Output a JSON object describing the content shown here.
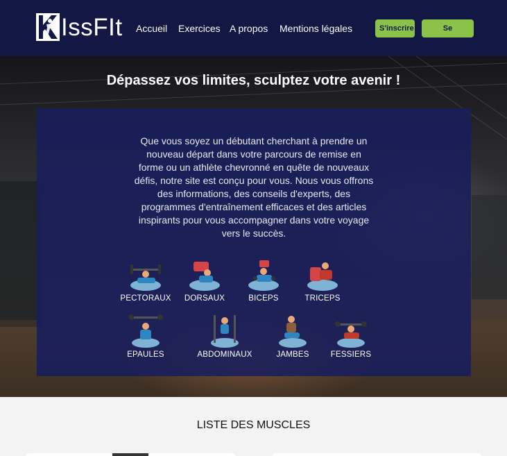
{
  "brand": {
    "name": "IssFIt"
  },
  "nav": {
    "items": [
      "Accueil",
      "Exercices",
      "A propos",
      "Mentions légales"
    ],
    "signup": "S'inscrire",
    "login": "Se connecter"
  },
  "hero": {
    "title": "Dépassez vos limites, sculptez votre avenir !",
    "intro": "Que vous soyez un débutant cherchant à prendre un nouveau départ dans votre parcours de remise en forme ou un athlète chevronné en quête de nouveaux défis, notre site est conçu pour vous. Nous vous offrons des informations, des conseils d'experts, des programmes d'entraînement efficaces et des articles inspirants pour vous accompagner dans votre voyage vers le succès."
  },
  "muscles": [
    {
      "label": "PECTORAUX",
      "icon": "bench-press-icon"
    },
    {
      "label": "DORSAUX",
      "icon": "rowing-machine-icon"
    },
    {
      "label": "BICEPS",
      "icon": "biceps-curl-icon"
    },
    {
      "label": "TRICEPS",
      "icon": "triceps-extension-icon"
    },
    {
      "label": "EPAULES",
      "icon": "shoulder-press-icon"
    },
    {
      "label": "ABDOMINAUX",
      "icon": "leg-raise-station-icon"
    },
    {
      "label": "JAMBES",
      "icon": "squat-icon"
    },
    {
      "label": "FESSIERS",
      "icon": "hip-thrust-icon"
    }
  ],
  "list": {
    "title": "LISTE DES MUSCLES"
  },
  "colors": {
    "header": "#121843",
    "accent": "#8bc34a",
    "panel": "#181e5c"
  }
}
